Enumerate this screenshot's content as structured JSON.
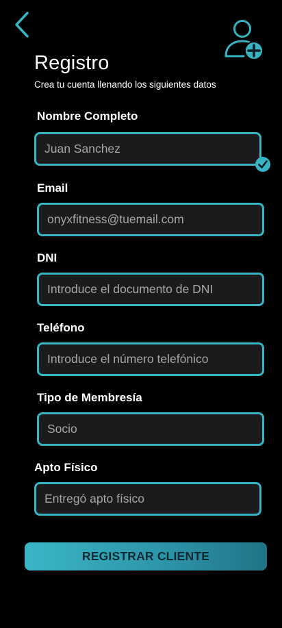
{
  "header": {
    "title": "Registro",
    "subtitle": "Crea tu cuenta llenando los siguientes datos"
  },
  "icons": {
    "back": "chevron-left-icon",
    "add_user": "add-user-icon",
    "valid": "check-icon"
  },
  "colors": {
    "accent": "#37b3c4",
    "field_background": "#1b1b1d",
    "field_text": "#a6a6a6",
    "background": "#000000",
    "button_text": "#0f2a33"
  },
  "form": {
    "full_name": {
      "label": "Nombre Completo",
      "value": "Juan Sanchez",
      "valid": true
    },
    "email": {
      "label": "Email",
      "placeholder": "onyxfitness@tuemail.com"
    },
    "dni": {
      "label": "DNI",
      "placeholder": "Introduce el documento de DNI"
    },
    "phone": {
      "label": "Teléfono",
      "placeholder": "Introduce el número telefónico"
    },
    "membership": {
      "label": "Tipo de Membresía",
      "value": "Socio"
    },
    "fitness": {
      "label": "Apto Físico",
      "placeholder": "Entregó apto físico"
    },
    "submit_label": "REGISTRAR CLIENTE"
  }
}
